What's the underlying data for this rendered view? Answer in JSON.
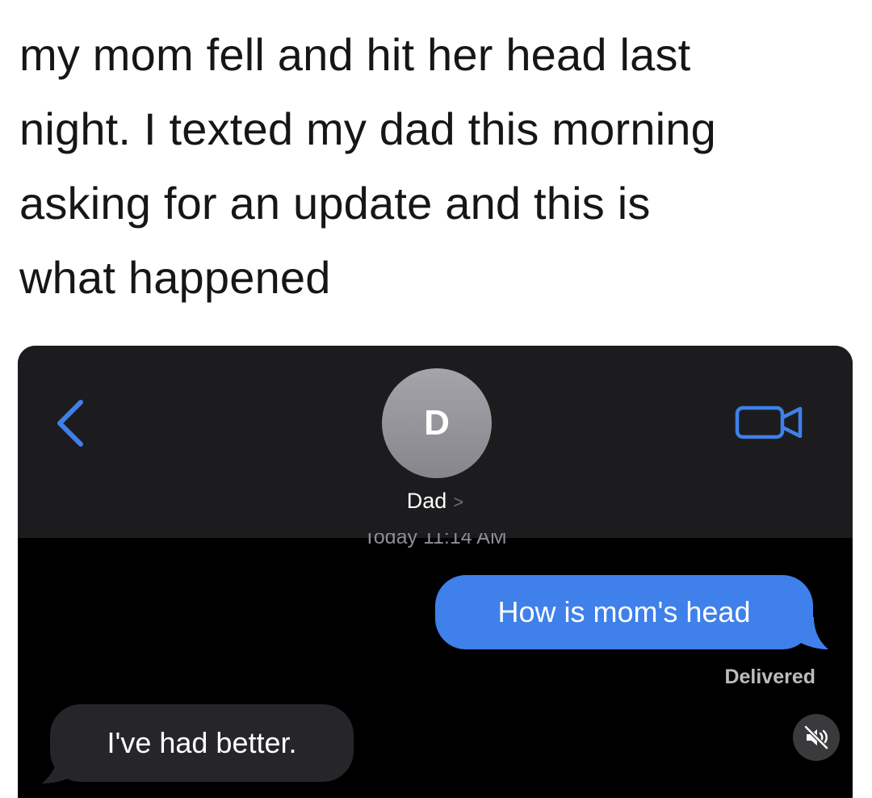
{
  "post": {
    "caption_lines": [
      "my mom fell and hit her head last",
      "night. I texted my dad this morning",
      "asking for an update and this is",
      "what happened"
    ]
  },
  "conversation": {
    "contact_initial": "D",
    "contact_name": "Dad",
    "contact_chevron": ">",
    "timestamp": "Today 11:14 AM",
    "messages": [
      {
        "sender": "me",
        "text": "How is mom's head"
      },
      {
        "sender": "dad",
        "text": "I've had better."
      }
    ],
    "delivery_status": "Delivered"
  },
  "icons": {
    "back": "chevron-left-icon",
    "video": "video-camera-icon",
    "mute": "speaker-muted-icon"
  },
  "colors": {
    "accent": "#3f80ea",
    "header_bg": "#1c1c1e",
    "received_bubble": "#26262a",
    "background": "#000000"
  }
}
